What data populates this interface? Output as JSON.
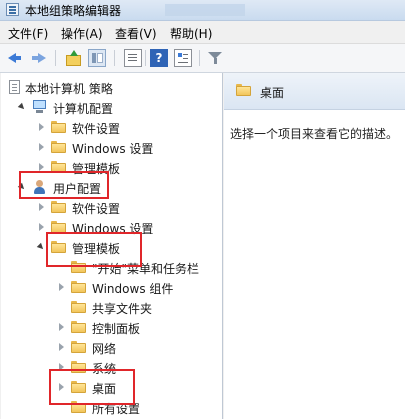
{
  "window": {
    "title": "本地组策略编辑器"
  },
  "menu": [
    "文件(F)",
    "操作(A)",
    "查看(V)",
    "帮助(H)"
  ],
  "toolbar": {
    "buttons": [
      "back-icon",
      "forward-icon",
      "up-icon",
      "pane-toggle-icon",
      "export-icon",
      "help-icon",
      "properties-icon",
      "filter-icon"
    ],
    "help_glyph": "?"
  },
  "tree": [
    {
      "label": "本地计算机 策略",
      "icon": "document-icon",
      "state": "none"
    },
    {
      "label": "计算机配置",
      "icon": "computer-icon",
      "state": "expanded"
    },
    {
      "label": "软件设置",
      "icon": "folder-icon",
      "state": "collapsed"
    },
    {
      "label": "Windows 设置",
      "icon": "folder-icon",
      "state": "collapsed"
    },
    {
      "label": "管理模板",
      "icon": "folder-icon",
      "state": "collapsed"
    },
    {
      "label": "用户配置",
      "icon": "user-icon",
      "state": "expanded",
      "highlighted": true
    },
    {
      "label": "软件设置",
      "icon": "folder-icon",
      "state": "collapsed"
    },
    {
      "label": "Windows 设置",
      "icon": "folder-icon",
      "state": "collapsed"
    },
    {
      "label": "管理模板",
      "icon": "folder-icon",
      "state": "expanded",
      "highlighted": true
    },
    {
      "label": "\"开始\"菜单和任务栏",
      "icon": "folder-icon",
      "state": "none"
    },
    {
      "label": "Windows 组件",
      "icon": "folder-icon",
      "state": "collapsed"
    },
    {
      "label": "共享文件夹",
      "icon": "folder-icon",
      "state": "none"
    },
    {
      "label": "控制面板",
      "icon": "folder-icon",
      "state": "collapsed"
    },
    {
      "label": "网络",
      "icon": "folder-icon",
      "state": "collapsed"
    },
    {
      "label": "系统",
      "icon": "folder-icon",
      "state": "collapsed"
    },
    {
      "label": "桌面",
      "icon": "folder-icon",
      "state": "collapsed",
      "highlighted": true,
      "selected": true
    },
    {
      "label": "所有设置",
      "icon": "settings-icon",
      "state": "none"
    }
  ],
  "details": {
    "title": "桌面",
    "description": "选择一个项目来查看它的描述。"
  },
  "colors": {
    "highlight_box": "#e0262a",
    "folder": "#f2c55b",
    "header_bg": "#dbe6f3"
  }
}
